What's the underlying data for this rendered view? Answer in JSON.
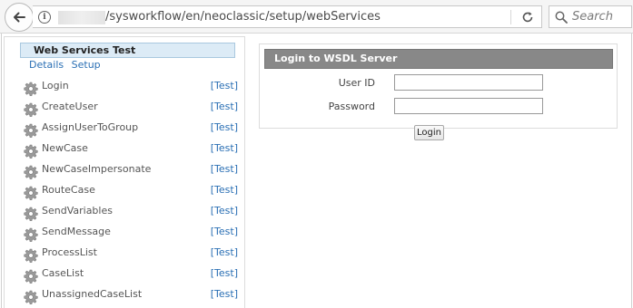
{
  "browser": {
    "url_text": "/sysworkflow/en/neoclassic/setup/webServices",
    "search_placeholder": "Search"
  },
  "left_panel": {
    "title": "Web Services Test",
    "tabs": [
      "Details",
      "Setup"
    ],
    "methods": [
      {
        "name": "Login",
        "action": "[Test]"
      },
      {
        "name": "CreateUser",
        "action": "[Test]"
      },
      {
        "name": "AssignUserToGroup",
        "action": "[Test]"
      },
      {
        "name": "NewCase",
        "action": "[Test]"
      },
      {
        "name": "NewCaseImpersonate",
        "action": "[Test]"
      },
      {
        "name": "RouteCase",
        "action": "[Test]"
      },
      {
        "name": "SendVariables",
        "action": "[Test]"
      },
      {
        "name": "SendMessage",
        "action": "[Test]"
      },
      {
        "name": "ProcessList",
        "action": "[Test]"
      },
      {
        "name": "CaseList",
        "action": "[Test]"
      },
      {
        "name": "UnassignedCaseList",
        "action": "[Test]"
      }
    ]
  },
  "login_form": {
    "header": "Login to WSDL Server",
    "user_id_label": "User ID",
    "user_id_value": "",
    "password_label": "Password",
    "password_value": "",
    "submit_label": "Login"
  }
}
